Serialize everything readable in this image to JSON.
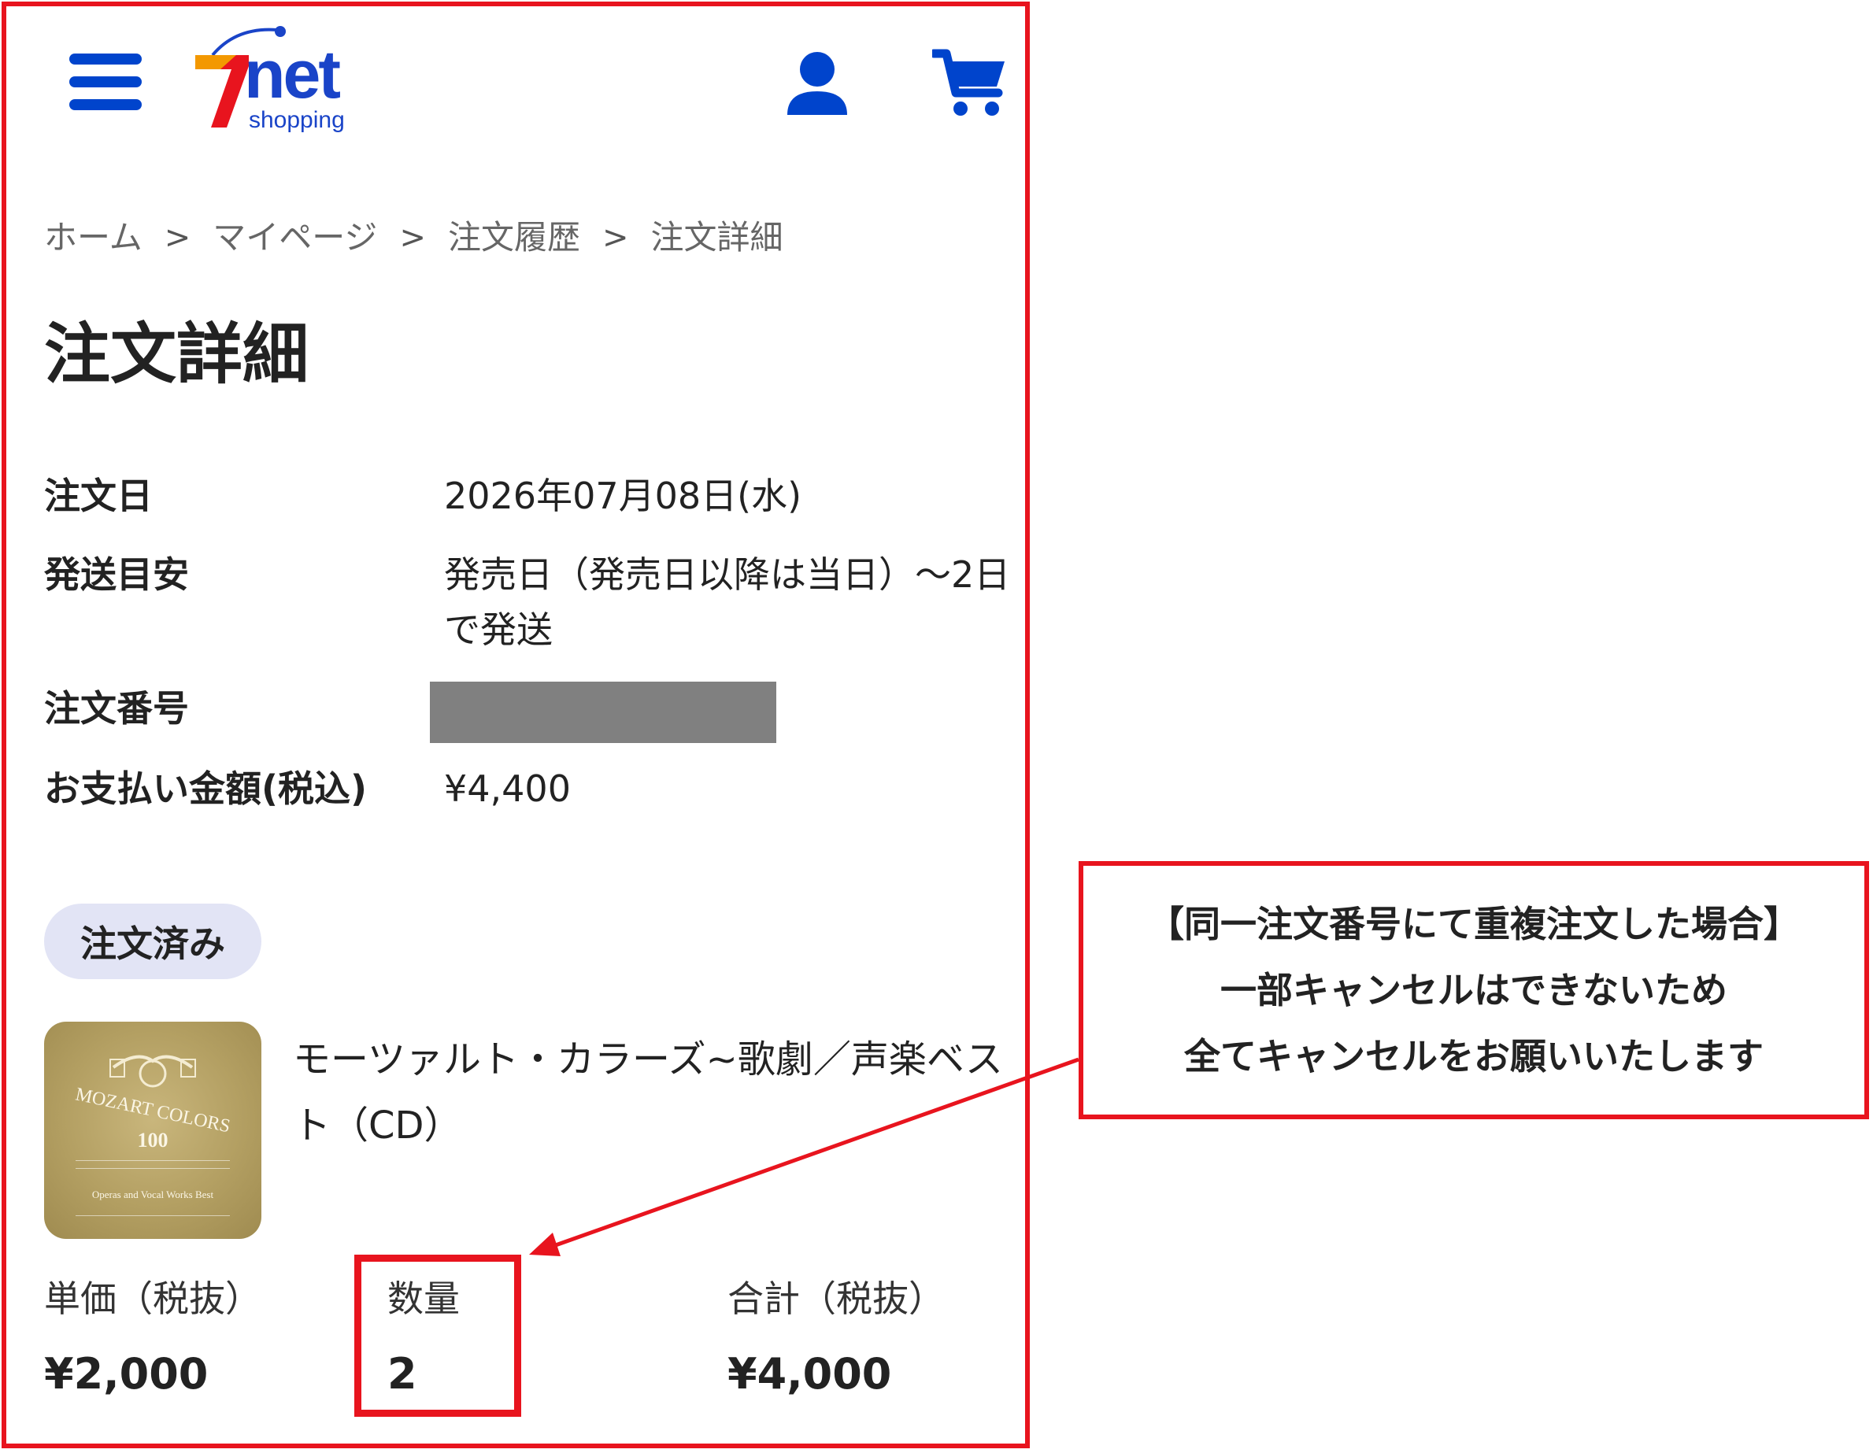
{
  "header": {
    "logo_mark": "7",
    "logo_text": "net",
    "logo_sub": "shopping",
    "menu_icon": "hamburger-menu-icon",
    "account_icon": "user-icon",
    "cart_icon": "cart-icon",
    "brand_blue": "#0044cc",
    "brand_red": "#e8141e",
    "brand_orange": "#f39800"
  },
  "breadcrumb": {
    "items": [
      "ホーム",
      "マイページ",
      "注文履歴",
      "注文詳細"
    ],
    "separator": ">"
  },
  "page": {
    "title": "注文詳細"
  },
  "order_info": {
    "order_date_label": "注文日",
    "order_date_value": "2026年07月08日(水)",
    "shipping_label": "発送目安",
    "shipping_value": "発売日（発売日以降は当日）〜2日で発送",
    "order_number_label": "注文番号",
    "payment_label": "お支払い金額(税込)",
    "payment_value": "¥4,400"
  },
  "status": {
    "label": "注文済み",
    "badge_color": "#e2e4f5"
  },
  "product": {
    "title": "モーツァルト・カラーズ~歌劇／声楽ベスト（CD）",
    "cover": {
      "title": "MOZART COLORS",
      "number": "100",
      "subtitle": "Operas and Vocal Works Best"
    }
  },
  "line_item": {
    "unit_price_label": "単価（税抜）",
    "unit_price_value": "¥2,000",
    "quantity_label": "数量",
    "quantity_value": "2",
    "total_label": "合計（税抜）",
    "total_value": "¥4,000"
  },
  "annotation": {
    "lines": [
      "【同一注文番号にて重複注文した場合】",
      "一部キャンセルはできないため",
      "全てキャンセルをお願いいたします"
    ],
    "color": "#e8141e"
  }
}
